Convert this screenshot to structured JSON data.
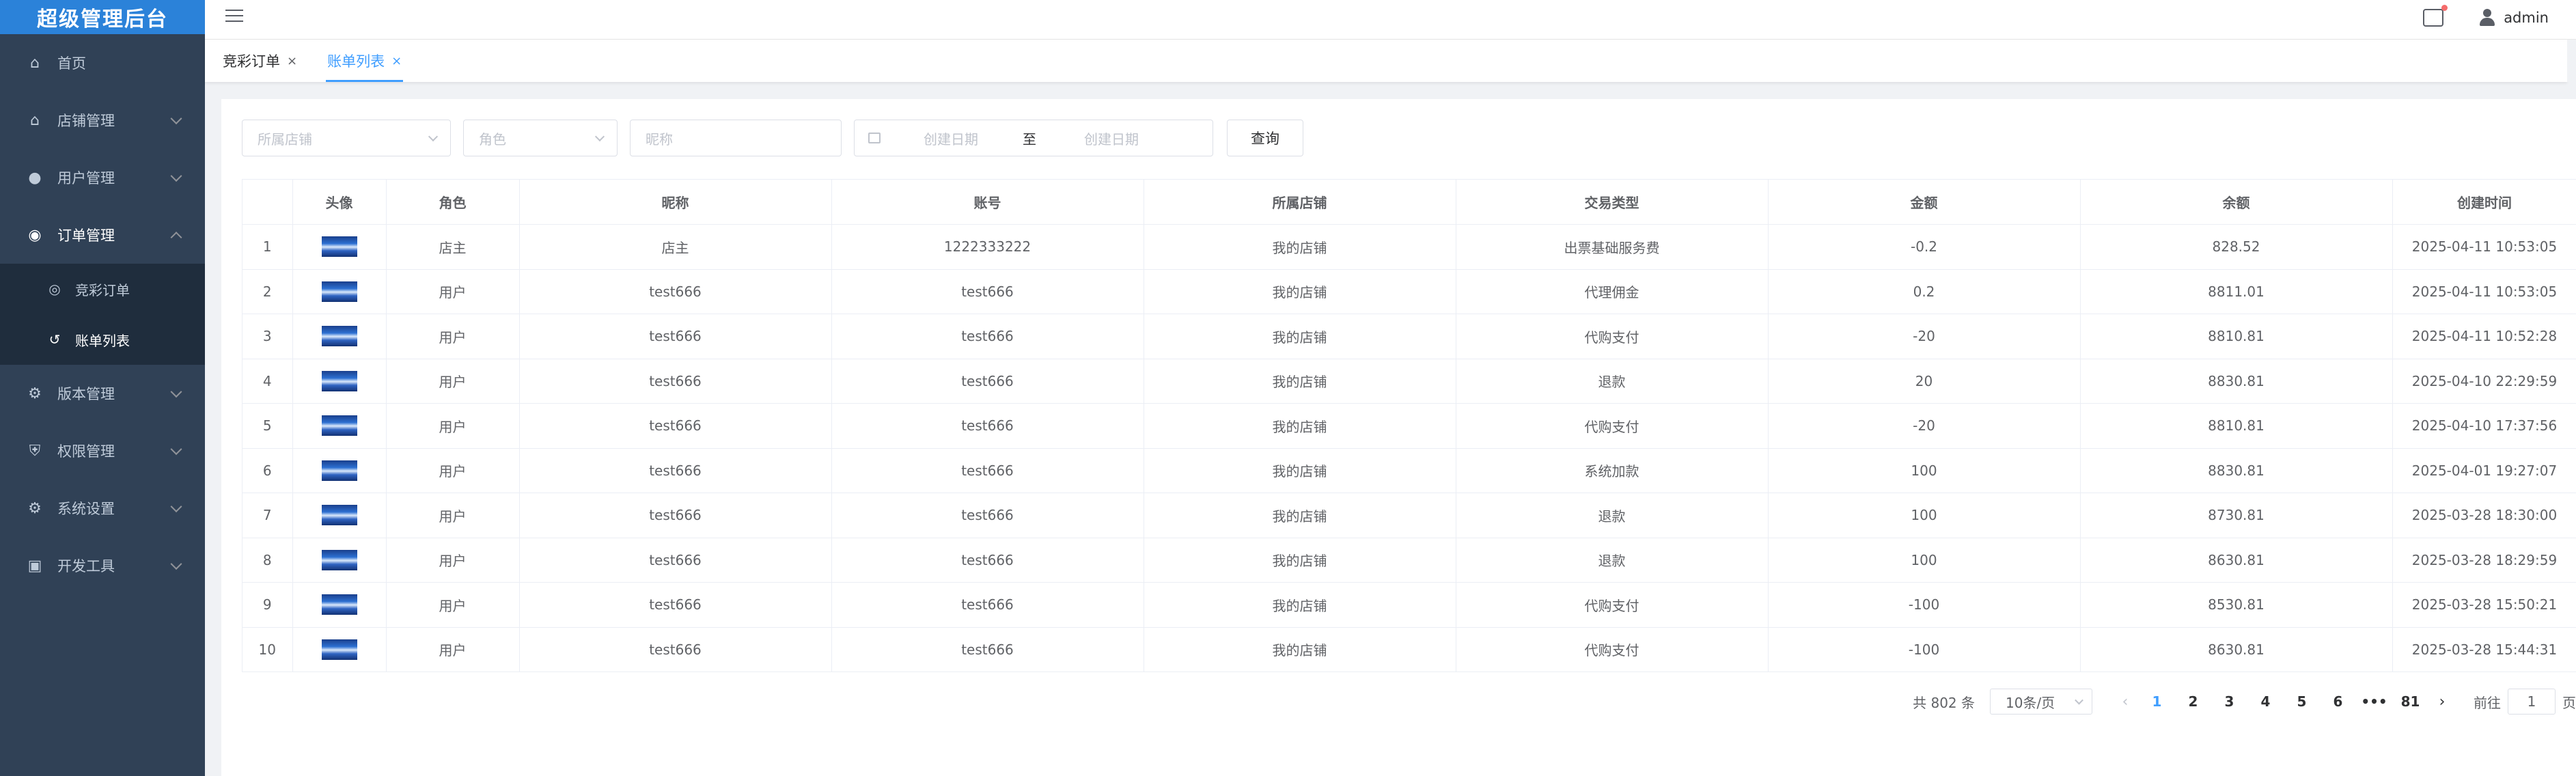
{
  "app": {
    "title": "超级管理后台"
  },
  "sidebar": {
    "items": [
      {
        "label": "首页",
        "icon": "home-icon"
      },
      {
        "label": "店铺管理",
        "icon": "shop-icon"
      },
      {
        "label": "用户管理",
        "icon": "user-icon"
      },
      {
        "label": "订单管理",
        "icon": "order-icon"
      },
      {
        "label": "版本管理",
        "icon": "version-icon"
      },
      {
        "label": "权限管理",
        "icon": "permission-icon"
      },
      {
        "label": "系统设置",
        "icon": "settings-icon"
      },
      {
        "label": "开发工具",
        "icon": "devtools-icon"
      }
    ],
    "sub": [
      {
        "label": "竞彩订单",
        "icon": "lottery-icon"
      },
      {
        "label": "账单列表",
        "icon": "bill-icon"
      }
    ]
  },
  "header": {
    "username": "admin"
  },
  "tags": [
    {
      "label": "竞彩订单",
      "close": "×"
    },
    {
      "label": "账单列表",
      "close": "×"
    }
  ],
  "filters": {
    "shop_placeholder": "所属店铺",
    "role_placeholder": "角色",
    "nickname_placeholder": "昵称",
    "start_placeholder": "创建日期",
    "range_sep": "至",
    "end_placeholder": "创建日期",
    "search_label": "查询"
  },
  "table": {
    "headers": [
      "",
      "头像",
      "角色",
      "昵称",
      "账号",
      "所属店铺",
      "交易类型",
      "金额",
      "余额",
      "创建时间"
    ],
    "rows": [
      [
        "1",
        "店主",
        "店主",
        "1222333222",
        "我的店铺",
        "出票基础服务费",
        "-0.2",
        "828.52",
        "2025-04-11 10:53:05"
      ],
      [
        "2",
        "用户",
        "test666",
        "test666",
        "我的店铺",
        "代理佣金",
        "0.2",
        "8811.01",
        "2025-04-11 10:53:05"
      ],
      [
        "3",
        "用户",
        "test666",
        "test666",
        "我的店铺",
        "代购支付",
        "-20",
        "8810.81",
        "2025-04-11 10:52:28"
      ],
      [
        "4",
        "用户",
        "test666",
        "test666",
        "我的店铺",
        "退款",
        "20",
        "8830.81",
        "2025-04-10 22:29:59"
      ],
      [
        "5",
        "用户",
        "test666",
        "test666",
        "我的店铺",
        "代购支付",
        "-20",
        "8810.81",
        "2025-04-10 17:37:56"
      ],
      [
        "6",
        "用户",
        "test666",
        "test666",
        "我的店铺",
        "系统加款",
        "100",
        "8830.81",
        "2025-04-01 19:27:07"
      ],
      [
        "7",
        "用户",
        "test666",
        "test666",
        "我的店铺",
        "退款",
        "100",
        "8730.81",
        "2025-03-28 18:30:00"
      ],
      [
        "8",
        "用户",
        "test666",
        "test666",
        "我的店铺",
        "退款",
        "100",
        "8630.81",
        "2025-03-28 18:29:59"
      ],
      [
        "9",
        "用户",
        "test666",
        "test666",
        "我的店铺",
        "代购支付",
        "-100",
        "8530.81",
        "2025-03-28 15:50:21"
      ],
      [
        "10",
        "用户",
        "test666",
        "test666",
        "我的店铺",
        "代购支付",
        "-100",
        "8630.81",
        "2025-03-28 15:44:31"
      ]
    ]
  },
  "pagination": {
    "total": "共 802 条",
    "page_size": "10条/页",
    "pages": [
      "1",
      "2",
      "3",
      "4",
      "5",
      "6",
      "•••",
      "81"
    ],
    "current": "1",
    "goto_prefix": "前往",
    "goto_value": "1",
    "goto_suffix": "页"
  }
}
